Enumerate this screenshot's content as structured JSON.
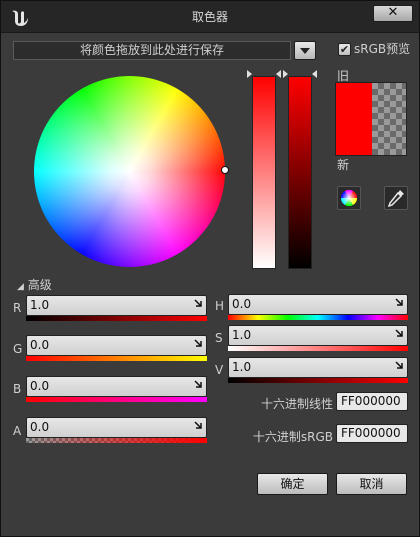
{
  "window": {
    "title": "取色器"
  },
  "toolbar": {
    "save_hint": "将颜色拖放到此处进行保存",
    "srgb_label": "sRGB预览",
    "srgb_checked": true
  },
  "preview": {
    "old_label": "旧",
    "new_label": "新",
    "old_color": "#ff0000",
    "new_color": "#ff0000"
  },
  "advanced": {
    "label": "高级",
    "rgba": [
      {
        "name": "R",
        "value": "1.0"
      },
      {
        "name": "G",
        "value": "0.0"
      },
      {
        "name": "B",
        "value": "0.0"
      },
      {
        "name": "A",
        "value": "0.0"
      }
    ],
    "hsv": [
      {
        "name": "H",
        "value": "0.0"
      },
      {
        "name": "S",
        "value": "1.0"
      },
      {
        "name": "V",
        "value": "1.0"
      }
    ],
    "hex_linear_label": "十六进制线性",
    "hex_linear_value": "FF000000",
    "hex_srgb_label": "十六进制sRGB",
    "hex_srgb_value": "FF000000"
  },
  "buttons": {
    "ok": "确定",
    "cancel": "取消"
  },
  "colors": {
    "selected": "#ff0000",
    "panel": "#3b3b3b",
    "titlebar": "#262626"
  }
}
